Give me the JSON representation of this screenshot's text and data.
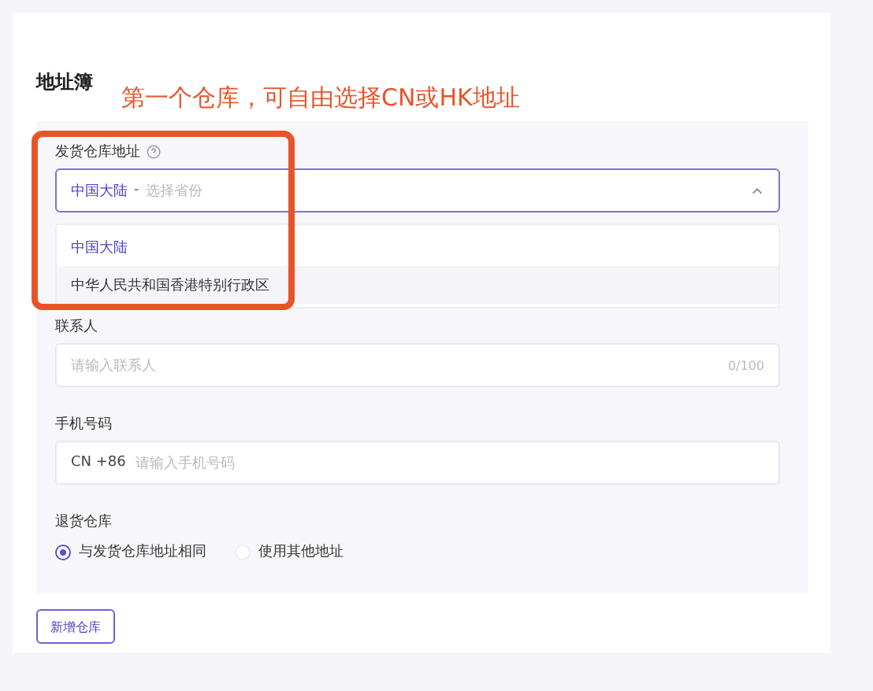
{
  "title": "地址簿",
  "annotation": {
    "text": "第一个仓库，可自由选择CN或HK地址"
  },
  "warehouse": {
    "label": "发货仓库地址",
    "select": {
      "value": "中国大陆",
      "separator": "-",
      "placeholder": "选择省份",
      "expanded": true
    },
    "options": [
      {
        "label": "中国大陆",
        "selected": true
      },
      {
        "label": "中华人民共和国香港特别行政区",
        "selected": false
      }
    ]
  },
  "contact": {
    "label": "联系人",
    "placeholder": "请输入联系人",
    "counter": "0/100"
  },
  "phone": {
    "label": "手机号码",
    "prefix": "CN +86",
    "placeholder": "请输入手机号码"
  },
  "return": {
    "label": "退货仓库",
    "options": [
      {
        "label": "与发货仓库地址相同",
        "selected": true
      },
      {
        "label": "使用其他地址",
        "selected": false
      }
    ]
  },
  "add_button": "新增仓库"
}
